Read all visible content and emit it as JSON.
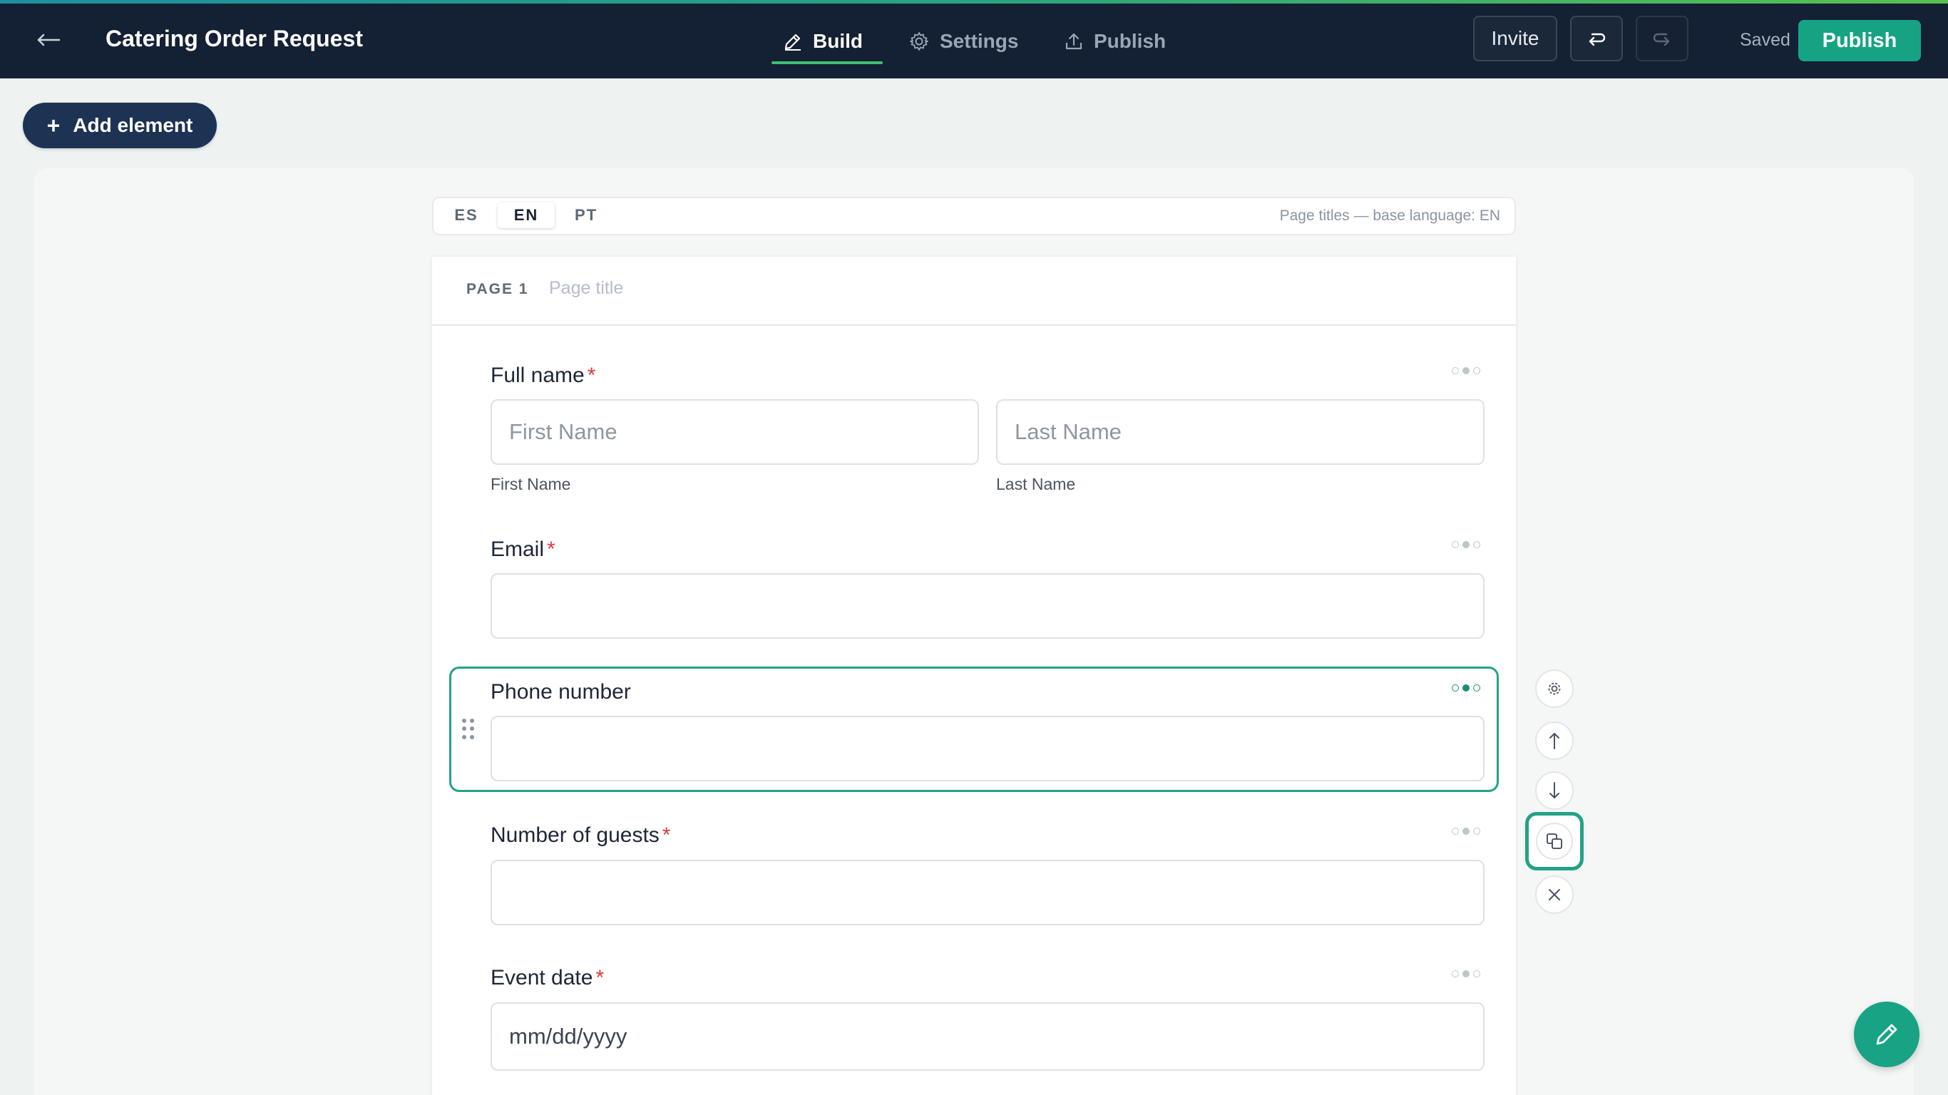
{
  "header": {
    "title": "Catering Order Request",
    "tabs": [
      {
        "label": "Build",
        "icon": "pencil-icon",
        "active": true
      },
      {
        "label": "Settings",
        "icon": "gear-icon",
        "active": false
      },
      {
        "label": "Publish",
        "icon": "upload-icon",
        "active": false
      }
    ],
    "invite_label": "Invite",
    "status": "Saved",
    "publish_label": "Publish",
    "accent_color": "#16a384"
  },
  "toolbar": {
    "add_element_label": "Add element"
  },
  "languages": {
    "items": [
      "ES",
      "EN",
      "PT"
    ],
    "active": "EN",
    "note": "Page titles — base language: EN"
  },
  "page": {
    "label": "PAGE 1",
    "title_placeholder": "Page title"
  },
  "fields": {
    "full_name": {
      "label": "Full name",
      "required": "*",
      "first_placeholder": "First Name",
      "last_placeholder": "Last Name",
      "first_sublabel": "First Name",
      "last_sublabel": "Last Name"
    },
    "email": {
      "label": "Email",
      "required": "*"
    },
    "phone": {
      "label": "Phone number",
      "selected": true
    },
    "guests": {
      "label": "Number of guests",
      "required": "*"
    },
    "event_date": {
      "label": "Event date",
      "required": "*",
      "placeholder": "mm/dd/yyyy"
    }
  }
}
